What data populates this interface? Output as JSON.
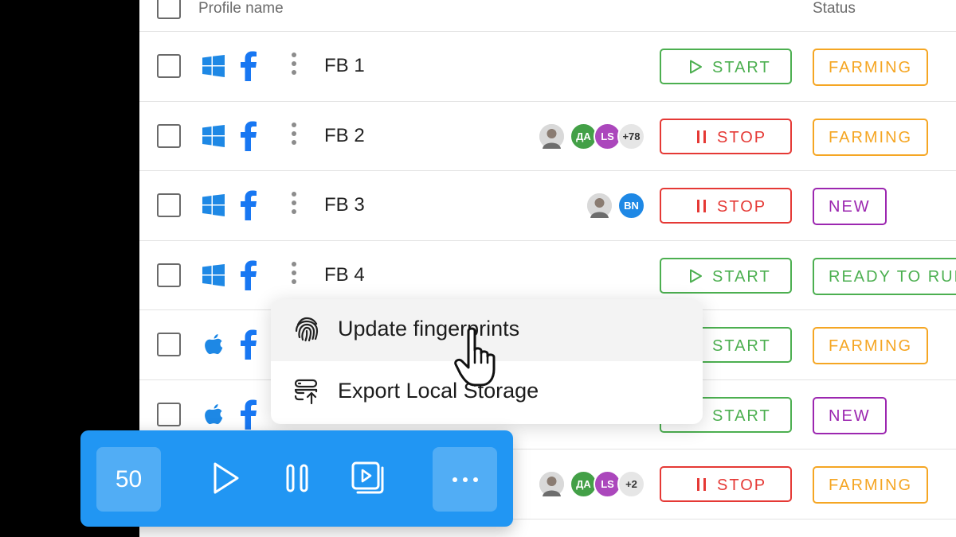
{
  "header": {
    "profile_name_label": "Profile name",
    "status_label": "Status"
  },
  "rows": [
    {
      "os": "windows",
      "name": "FB 1",
      "action": "START",
      "status": "FARMING",
      "avatars": []
    },
    {
      "os": "windows",
      "name": "FB 2",
      "action": "STOP",
      "status": "FARMING",
      "avatars": [
        "photo",
        "ДА",
        "LS",
        "+78"
      ]
    },
    {
      "os": "windows",
      "name": "FB 3",
      "action": "STOP",
      "status": "NEW",
      "avatars": [
        "photo",
        "BN"
      ]
    },
    {
      "os": "windows",
      "name": "FB 4",
      "action": "START",
      "status": "READY TO RUN",
      "avatars": []
    },
    {
      "os": "apple",
      "name": "",
      "action": "START",
      "status": "FARMING",
      "avatars": []
    },
    {
      "os": "apple",
      "name": "",
      "action": "START",
      "status": "NEW",
      "avatars": []
    },
    {
      "os": "apple",
      "name": "",
      "action": "STOP",
      "status": "FARMING",
      "avatars": [
        "photo",
        "ДА",
        "LS",
        "+2"
      ]
    }
  ],
  "context_menu": {
    "items": [
      {
        "label": "Update fingerprints",
        "icon": "fingerprint-icon",
        "highlighted": true
      },
      {
        "label": "Export Local Storage",
        "icon": "export-storage-icon",
        "highlighted": false
      }
    ]
  },
  "toolbar": {
    "selected_count": "50"
  },
  "colors": {
    "accent": "#2196f3",
    "start": "#4caf50",
    "stop": "#e53935",
    "farming": "#f5a623",
    "new": "#9c27b0",
    "windows": "#1e88e5",
    "facebook": "#1877f2"
  }
}
